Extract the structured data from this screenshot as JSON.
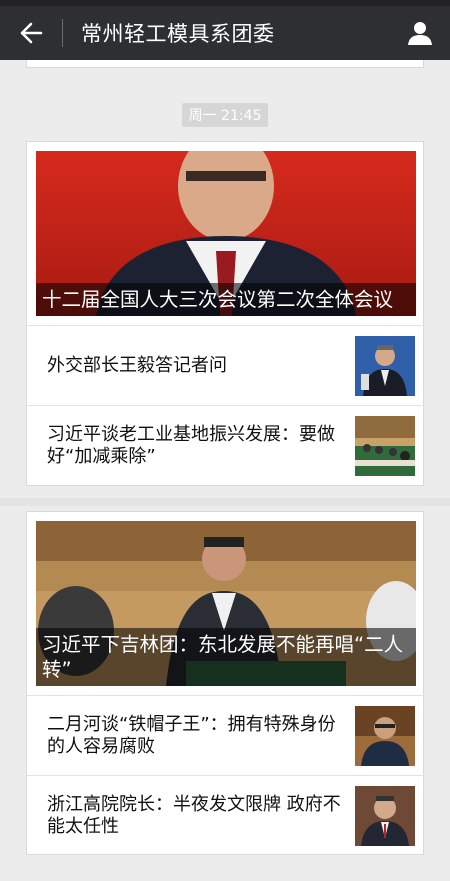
{
  "header": {
    "title": "常州轻工模具系团委",
    "back_icon": "back-arrow-icon",
    "profile_icon": "person-icon",
    "background": "#2d2f33"
  },
  "timestamp": "周一 21:45",
  "cards": [
    {
      "hero_caption": "十二届全国人大三次会议第二次全体会议",
      "items": [
        {
          "title": "外交部长王毅答记者问"
        },
        {
          "title": "习近平谈老工业基地振兴发展：要做好“加减乘除”"
        }
      ]
    },
    {
      "hero_caption": "习近平下吉林团：东北发展不能再唱“二人转”",
      "items": [
        {
          "title": "二月河谈“铁帽子王”：拥有特殊身份的人容易腐败"
        },
        {
          "title": "浙江高院院长：半夜发文限牌 政府不能太任性"
        }
      ]
    }
  ]
}
